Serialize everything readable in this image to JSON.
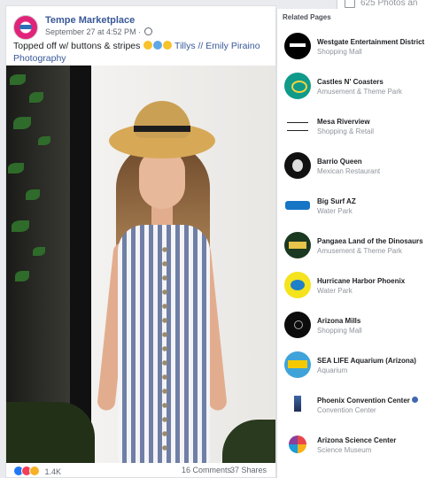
{
  "background_window": {
    "text": "625 Photos an"
  },
  "post": {
    "page_name": "Tempe Marketplace",
    "timestamp": "September 27 at 4:52 PM",
    "privacy_separator": "·",
    "text_prefix": "Topped off w/ buttons & stripes",
    "tag_1": "Tillys",
    "tag_separator": "//",
    "tag_2": "Emily Piraino Photography",
    "reaction_count": "1.4K",
    "comments": "16 Comments",
    "shares": "37 Shares"
  },
  "related_pages": {
    "title": "Related Pages",
    "items": [
      {
        "name": "Westgate Entertainment District",
        "category": "Shopping Mall"
      },
      {
        "name": "Castles N' Coasters",
        "category": "Amusement & Theme Park"
      },
      {
        "name": "Mesa Riverview",
        "category": "Shopping & Retail"
      },
      {
        "name": "Barrio Queen",
        "category": "Mexican Restaurant"
      },
      {
        "name": "Big Surf AZ",
        "category": "Water Park"
      },
      {
        "name": "Pangaea Land of the Dinosaurs",
        "category": "Amusement & Theme Park"
      },
      {
        "name": "Hurricane Harbor Phoenix",
        "category": "Water Park"
      },
      {
        "name": "Arizona Mills",
        "category": "Shopping Mall"
      },
      {
        "name": "SEA LIFE Aquarium (Arizona)",
        "category": "Aquarium"
      },
      {
        "name": "Phoenix Convention Center",
        "category": "Convention Center"
      },
      {
        "name": "Arizona Science Center",
        "category": "Science Museum"
      }
    ]
  },
  "colors": {
    "link": "#385898",
    "verified": "#4267b2",
    "like": "#2078f4",
    "love": "#f33e58",
    "wow": "#f7b125"
  },
  "icons": {
    "privacy": "globe-icon",
    "verified": "verified-badge-icon"
  }
}
